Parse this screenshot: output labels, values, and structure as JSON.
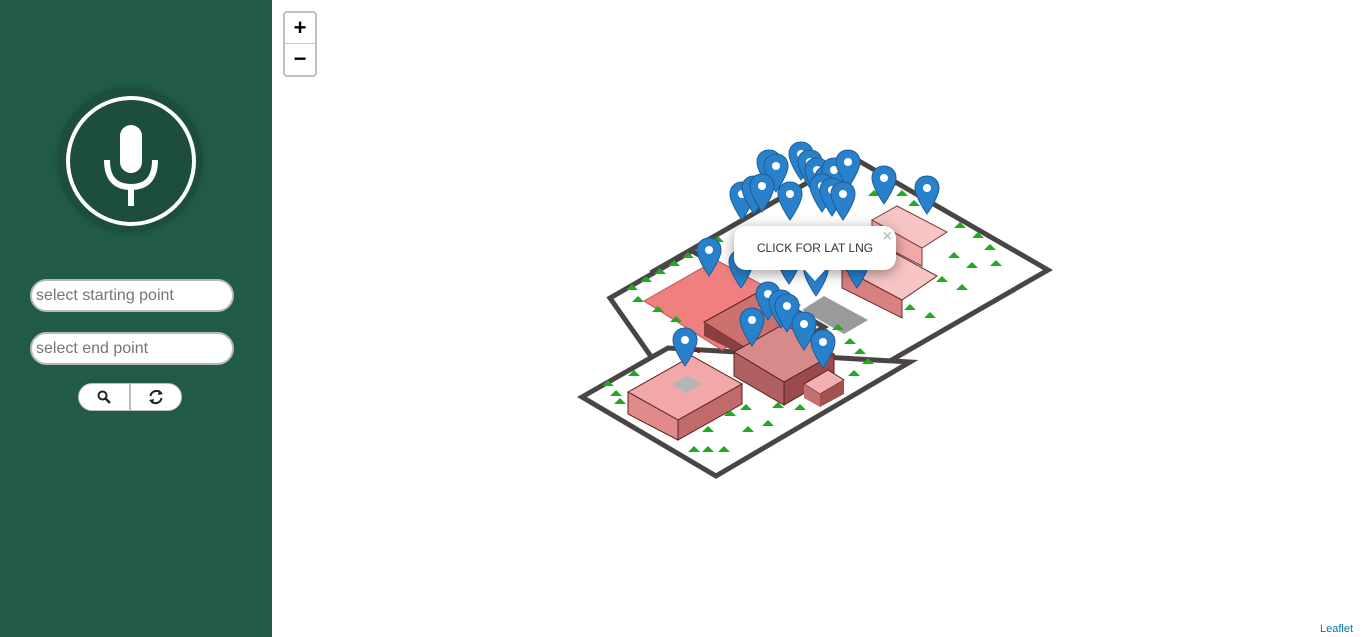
{
  "sidebar": {
    "voice_button_icon": "microphone-icon",
    "start_placeholder": "select starting point",
    "end_placeholder": "select end point",
    "search_icon": "search-icon",
    "reset_icon": "refresh-icon",
    "background_color": "#215a47"
  },
  "map": {
    "zoom_in_label": "+",
    "zoom_out_label": "−",
    "popup_text": "CLICK FOR LAT LNG",
    "popup_close": "×",
    "attribution": "Leaflet",
    "marker_color": "#2a81cb",
    "marker_icon": "map-marker-icon"
  }
}
